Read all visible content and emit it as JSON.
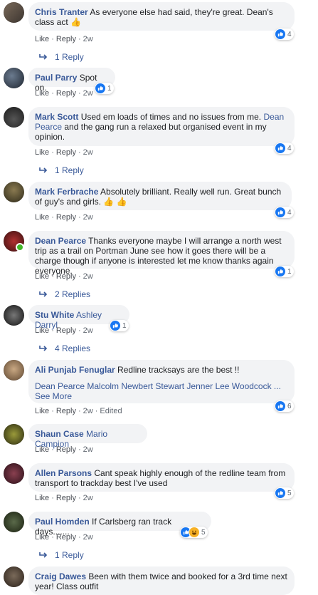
{
  "comments": [
    {
      "author": "Chris Tranter",
      "text": "As everyone else had said, they're great. Dean's class act",
      "emoji": "👍",
      "reactions": "4",
      "actions": {
        "like": "Like",
        "reply": "Reply",
        "time": "2w"
      },
      "replies": "1 Reply"
    },
    {
      "author": "Paul Parry",
      "text": "Spot on.",
      "reactions": "1",
      "actions": {
        "like": "Like",
        "reply": "Reply",
        "time": "2w"
      }
    },
    {
      "author": "Mark Scott",
      "text_before": "Used em loads of times and no issues from me.",
      "tag": "Dean Pearce",
      "text_after": "and the gang run a relaxed but organised event in my opinion.",
      "reactions": "4",
      "actions": {
        "like": "Like",
        "reply": "Reply",
        "time": "2w"
      },
      "replies": "1 Reply"
    },
    {
      "author": "Mark Ferbrache",
      "text": "Absolutely brilliant. Really well run. Great bunch of guy's and girls.",
      "emoji": "👍 👍",
      "reactions": "4",
      "actions": {
        "like": "Like",
        "reply": "Reply",
        "time": "2w"
      }
    },
    {
      "author": "Dean Pearce",
      "text": "Thanks everyone maybe I will arrange a north west trip as a trail on Portman June see how it goes there will be a charge though if anyone is interested let me know thanks again everyone.",
      "reactions": "1",
      "actions": {
        "like": "Like",
        "reply": "Reply",
        "time": "2w"
      },
      "replies": "2 Replies"
    },
    {
      "author": "Stu White",
      "tag": "Ashley Darryl",
      "reactions": "1",
      "actions": {
        "like": "Like",
        "reply": "Reply",
        "time": "2w"
      },
      "replies": "4 Replies"
    },
    {
      "author": "Ali Punjab Fenuglar",
      "text": "Redline tracksays are the best !!",
      "tags_line": "Dean Pearce Malcolm Newbert Stewart Jenner Lee Woodcock ...",
      "see_more": "See More",
      "reactions": "6",
      "actions": {
        "like": "Like",
        "reply": "Reply",
        "time": "2w",
        "edited": "Edited"
      }
    },
    {
      "author": "Shaun Case",
      "tag": "Mario Campion",
      "actions": {
        "like": "Like",
        "reply": "Reply",
        "time": "2w"
      }
    },
    {
      "author": "Allen Parsons",
      "text": "Cant speak highly enough of the redline team from transport to trackday best I've used",
      "reactions": "5",
      "actions": {
        "like": "Like",
        "reply": "Reply",
        "time": "2w"
      }
    },
    {
      "author": "Paul Homden",
      "text": "If Carlsberg ran track days.......",
      "reactions": "5",
      "actions": {
        "like": "Like",
        "reply": "Reply",
        "time": "2w"
      },
      "replies": "1 Reply"
    },
    {
      "author": "Craig Dawes",
      "text": "Been with them twice and booked for a 3rd time next year! Class outfit"
    }
  ],
  "colors": {
    "link": "#385898",
    "bubble": "#f2f3f5",
    "like": "#1877f2",
    "meta": "#606770"
  }
}
